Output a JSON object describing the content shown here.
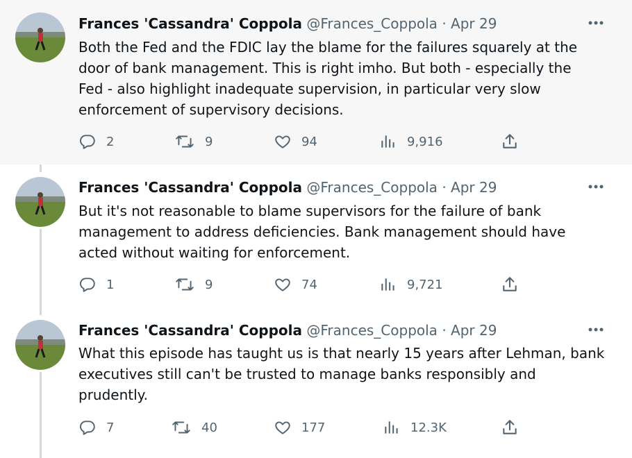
{
  "tweets": [
    {
      "display_name": "Frances 'Cassandra' Coppola",
      "handle": "@Frances_Coppola",
      "separator": "·",
      "date": "Apr 29",
      "lines": [
        "Both the Fed and the FDIC lay the blame for the failures squarely at the",
        "door of bank management. This is right imho. But both - especially the",
        "Fed - also highlight inadequate supervision, in particular very slow",
        "enforcement of supervisory decisions."
      ],
      "replies": "2",
      "retweets": "9",
      "likes": "94",
      "views": "9,916"
    },
    {
      "display_name": "Frances 'Cassandra' Coppola",
      "handle": "@Frances_Coppola",
      "separator": "·",
      "date": "Apr 29",
      "lines": [
        "But it's not reasonable to blame supervisors for the failure of bank",
        "management to address deficiencies. Bank management should have",
        "acted without waiting for enforcement."
      ],
      "replies": "1",
      "retweets": "9",
      "likes": "74",
      "views": "9,721"
    },
    {
      "display_name": "Frances 'Cassandra' Coppola",
      "handle": "@Frances_Coppola",
      "separator": "·",
      "date": "Apr 29",
      "lines": [
        "What this episode has taught us is that nearly 15 years after Lehman, bank",
        "executives still can't be trusted to manage banks responsibly and",
        "prudently."
      ],
      "replies": "7",
      "retweets": "40",
      "likes": "177",
      "views": "12.3K"
    }
  ],
  "icons": {
    "reply": "reply-icon",
    "retweet": "retweet-icon",
    "like": "heart-icon",
    "views": "views-icon",
    "share": "share-icon",
    "more": "more-icon"
  },
  "colors": {
    "text": "#0f1419",
    "secondary": "#536471",
    "thread_line": "#cfd9de",
    "highlight_bg": "#f7f7f7"
  }
}
